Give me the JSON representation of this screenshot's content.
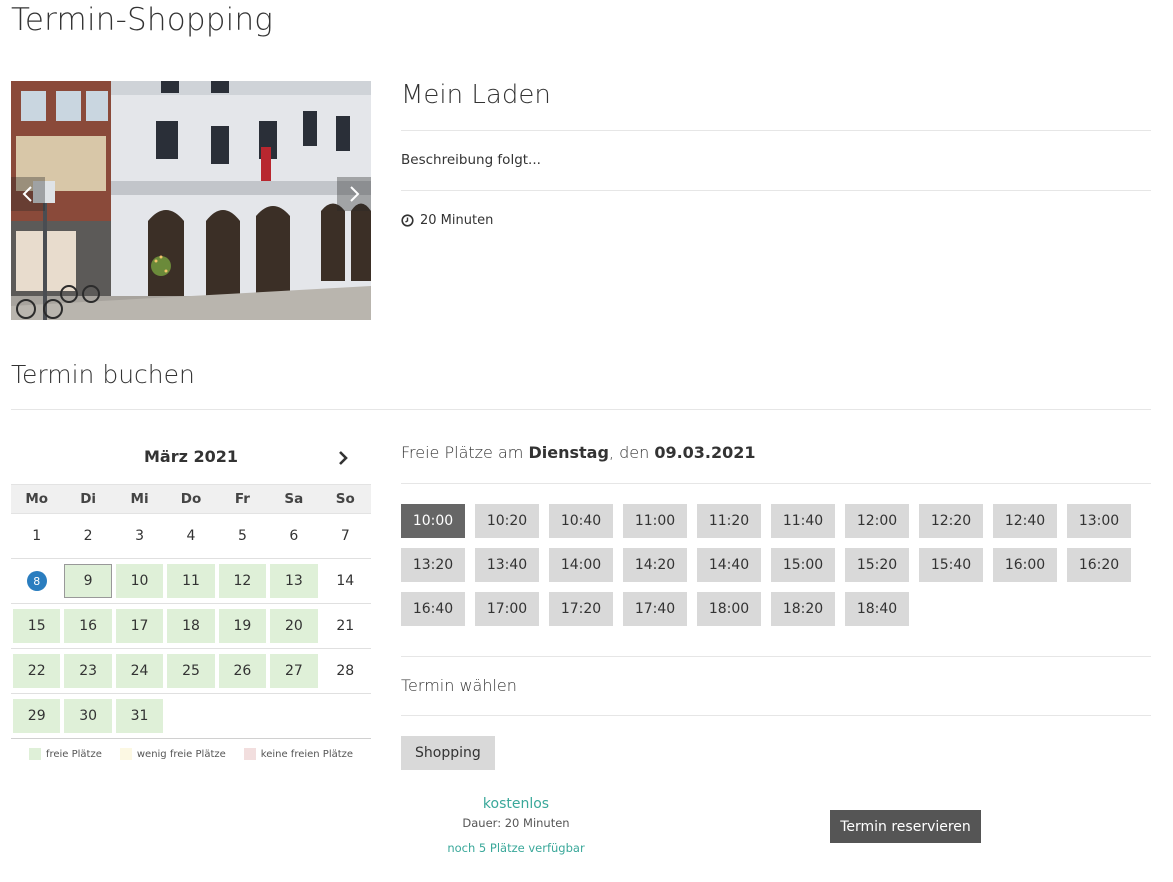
{
  "page": {
    "title": "Termin-Shopping"
  },
  "shop": {
    "name": "Mein Laden",
    "description": "Beschreibung folgt...",
    "duration": "20 Minuten"
  },
  "booking": {
    "section_title": "Termin buchen",
    "calendar": {
      "month_label": "März 2021",
      "weekdays": [
        "Mo",
        "Di",
        "Mi",
        "Do",
        "Fr",
        "Sa",
        "So"
      ],
      "weeks": [
        [
          {
            "d": "1",
            "s": "none"
          },
          {
            "d": "2",
            "s": "none"
          },
          {
            "d": "3",
            "s": "none"
          },
          {
            "d": "4",
            "s": "none"
          },
          {
            "d": "5",
            "s": "none"
          },
          {
            "d": "6",
            "s": "none"
          },
          {
            "d": "7",
            "s": "none"
          }
        ],
        [
          {
            "d": "8",
            "s": "today"
          },
          {
            "d": "9",
            "s": "selected"
          },
          {
            "d": "10",
            "s": "free"
          },
          {
            "d": "11",
            "s": "free"
          },
          {
            "d": "12",
            "s": "free"
          },
          {
            "d": "13",
            "s": "free"
          },
          {
            "d": "14",
            "s": "none"
          }
        ],
        [
          {
            "d": "15",
            "s": "free"
          },
          {
            "d": "16",
            "s": "free"
          },
          {
            "d": "17",
            "s": "free"
          },
          {
            "d": "18",
            "s": "free"
          },
          {
            "d": "19",
            "s": "free"
          },
          {
            "d": "20",
            "s": "free"
          },
          {
            "d": "21",
            "s": "none"
          }
        ],
        [
          {
            "d": "22",
            "s": "free"
          },
          {
            "d": "23",
            "s": "free"
          },
          {
            "d": "24",
            "s": "free"
          },
          {
            "d": "25",
            "s": "free"
          },
          {
            "d": "26",
            "s": "free"
          },
          {
            "d": "27",
            "s": "free"
          },
          {
            "d": "28",
            "s": "none"
          }
        ],
        [
          {
            "d": "29",
            "s": "free"
          },
          {
            "d": "30",
            "s": "free"
          },
          {
            "d": "31",
            "s": "free"
          },
          {
            "d": "",
            "s": "empty"
          },
          {
            "d": "",
            "s": "empty"
          },
          {
            "d": "",
            "s": "empty"
          },
          {
            "d": "",
            "s": "empty"
          }
        ]
      ],
      "legend": [
        {
          "label": "freie Plätze",
          "color": "#dff0d8"
        },
        {
          "label": "wenig freie Plätze",
          "color": "#fcf8e3"
        },
        {
          "label": "keine freien Plätze",
          "color": "#f2dede"
        }
      ]
    },
    "slots_heading": {
      "prefix": "Freie Plätze am ",
      "weekday": "Dienstag",
      "middle": ", den ",
      "date": "09.03.2021"
    },
    "slots": [
      "10:00",
      "10:20",
      "10:40",
      "11:00",
      "11:20",
      "11:40",
      "12:00",
      "12:20",
      "12:40",
      "13:00",
      "13:20",
      "13:40",
      "14:00",
      "14:20",
      "14:40",
      "15:00",
      "15:20",
      "15:40",
      "16:00",
      "16:20",
      "16:40",
      "17:00",
      "17:20",
      "17:40",
      "18:00",
      "18:20",
      "18:40"
    ],
    "active_slot": "10:00",
    "choose_title": "Termin wählen",
    "appointment_type": "Shopping",
    "price": "kostenlos",
    "duration_text": "Dauer: 20 Minuten",
    "availability": "noch 5 Plätze verfügbar",
    "reserve_label": "Termin reservieren"
  },
  "colors": {
    "free": "#dff0d8",
    "today_badge": "#2a7dbf",
    "active_slot": "#666666",
    "accent_teal": "#3aa89a",
    "reserve_button": "#555555"
  }
}
